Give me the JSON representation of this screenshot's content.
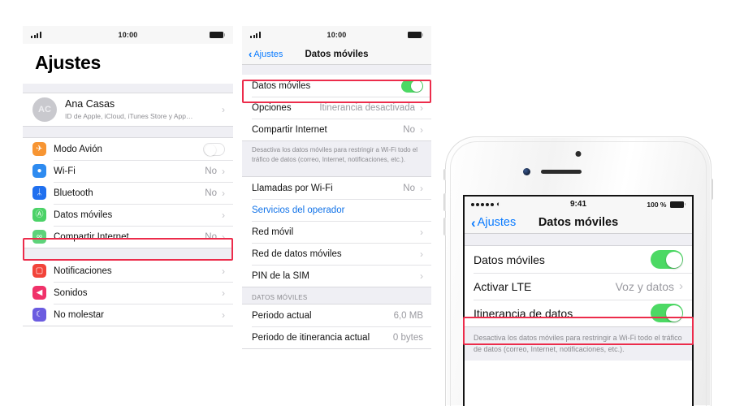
{
  "panel1": {
    "status": {
      "time": "10:00",
      "signal_icon": "signal-bars-icon",
      "battery_icon": "battery-icon"
    },
    "title": "Ajustes",
    "account": {
      "initials": "AC",
      "name": "Ana Casas",
      "subtitle": "ID de Apple, iCloud, iTunes Store y App…"
    },
    "group1": [
      {
        "icon": "airplane-icon",
        "glyph": "✈",
        "color": "#f79533",
        "label": "Modo Avión",
        "type": "toggle",
        "value": "off"
      },
      {
        "icon": "wifi-icon",
        "glyph": "●",
        "color": "#2e8bf0",
        "label": "Wi-Fi",
        "type": "value",
        "value": "No"
      },
      {
        "icon": "bluetooth-icon",
        "glyph": "ᛦ",
        "color": "#2070ef",
        "label": "Bluetooth",
        "type": "value",
        "value": "No"
      },
      {
        "icon": "cellular-antenna-icon",
        "glyph": "Ⓐ",
        "color": "#4bd267",
        "label": "Datos móviles",
        "type": "chevron",
        "value": ""
      },
      {
        "icon": "hotspot-icon",
        "glyph": "∞",
        "color": "#5ed37a",
        "label": "Compartir Internet",
        "type": "value",
        "value": "No"
      }
    ],
    "group2": [
      {
        "icon": "notifications-icon",
        "glyph": "▢",
        "color": "#f2443a",
        "label": "Notificaciones",
        "type": "chevron",
        "value": ""
      },
      {
        "icon": "sounds-icon",
        "glyph": "◀",
        "color": "#f0326a",
        "label": "Sonidos",
        "type": "chevron",
        "value": ""
      },
      {
        "icon": "do-not-disturb-icon",
        "glyph": "☾",
        "color": "#6b5ce0",
        "label": "No molestar",
        "type": "chevron",
        "value": ""
      }
    ],
    "highlight_row_label": "Datos móviles"
  },
  "panel2": {
    "status": {
      "time": "10:00",
      "signal_icon": "signal-bars-icon",
      "battery_icon": "battery-icon"
    },
    "nav": {
      "back_label": "Ajustes",
      "title": "Datos móviles"
    },
    "group1": [
      {
        "label": "Datos móviles",
        "type": "toggle",
        "value": "on"
      },
      {
        "label": "Opciones",
        "type": "value",
        "value": "Itinerancia desactivada"
      },
      {
        "label": "Compartir Internet",
        "type": "value",
        "value": "No"
      }
    ],
    "footnote": "Desactiva los datos móviles para restringir a Wi-Fi todo el tráfico de datos (correo, Internet, notificaciones, etc.).",
    "group2": [
      {
        "label": "Llamadas por Wi-Fi",
        "type": "value",
        "value": "No"
      },
      {
        "label": "Servicios del operador",
        "type": "link",
        "value": ""
      },
      {
        "label": "Red móvil",
        "type": "chevron",
        "value": ""
      },
      {
        "label": "Red de datos móviles",
        "type": "chevron",
        "value": ""
      },
      {
        "label": "PIN de la SIM",
        "type": "chevron",
        "value": ""
      }
    ],
    "section_header": "DATOS MÓVILES",
    "group3": [
      {
        "label": "Periodo actual",
        "type": "plainvalue",
        "value": "6,0 MB"
      },
      {
        "label": "Periodo de itinerancia actual",
        "type": "plainvalue",
        "value": "0 bytes"
      }
    ],
    "highlight_row_label": "Datos móviles"
  },
  "phone": {
    "status": {
      "signal_icon": "signal-dots-icon",
      "wifi_icon": "wifi-icon",
      "time": "9:41",
      "battery_pct": "100 %",
      "battery_icon": "battery-icon"
    },
    "nav": {
      "back_label": "Ajustes",
      "title": "Datos móviles"
    },
    "rows": [
      {
        "label": "Datos móviles",
        "type": "toggle",
        "value": "on"
      },
      {
        "label": "Activar LTE",
        "type": "value",
        "value": "Voz y datos"
      },
      {
        "label": "Itinerancia de datos",
        "type": "toggle",
        "value": "on"
      }
    ],
    "footnote": "Desactiva los datos móviles para restringir a Wi-Fi todo el tráfico de datos (correo, Internet, notificaciones, etc.).",
    "highlight_row_label": "Itinerancia de datos"
  },
  "colors": {
    "highlight": "#ec2c4b",
    "toggle_on": "#4cd964",
    "link": "#0a7bff",
    "chevron": "#c4c4c8"
  }
}
